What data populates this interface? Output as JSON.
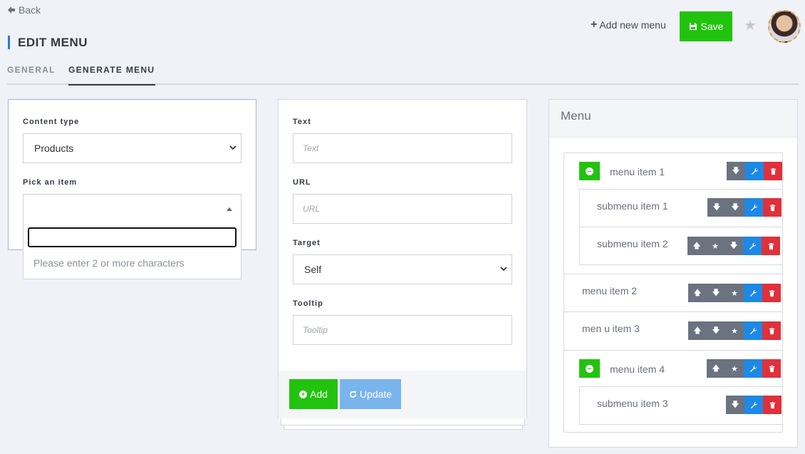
{
  "nav": {
    "back_label": "Back"
  },
  "page": {
    "title": "EDIT MENU"
  },
  "tabs": [
    {
      "label": "GENERAL"
    },
    {
      "label": "GENERATE MENU"
    }
  ],
  "header": {
    "add_new_label": "Add new menu",
    "save_label": "Save"
  },
  "left_panel": {
    "content_type_label": "Content type",
    "content_type_value": "Products",
    "pick_item_label": "Pick an item",
    "dropdown_message": "Please enter 2 or more characters"
  },
  "mid_panel": {
    "text_label": "Text",
    "text_placeholder": "Text",
    "url_label": "URL",
    "url_placeholder": "URL",
    "target_label": "Target",
    "target_value": "Self",
    "tooltip_label": "Tooltip",
    "tooltip_placeholder": "Tooltip",
    "add_label": "Add",
    "update_label": "Update"
  },
  "menu_panel": {
    "title": "Menu",
    "items": {
      "item1": "menu item 1",
      "sub1": "submenu item 1",
      "sub2": "submenu item 2",
      "item2": "menu item 2",
      "item3": "men u item 3",
      "item4": "menu item 4",
      "sub3": "submenu item 3"
    }
  },
  "colors": {
    "green": "#22c30e",
    "blue": "#1e88e5",
    "red": "#e0313b",
    "gray": "#6b7280",
    "accent": "#1f7fd6"
  }
}
